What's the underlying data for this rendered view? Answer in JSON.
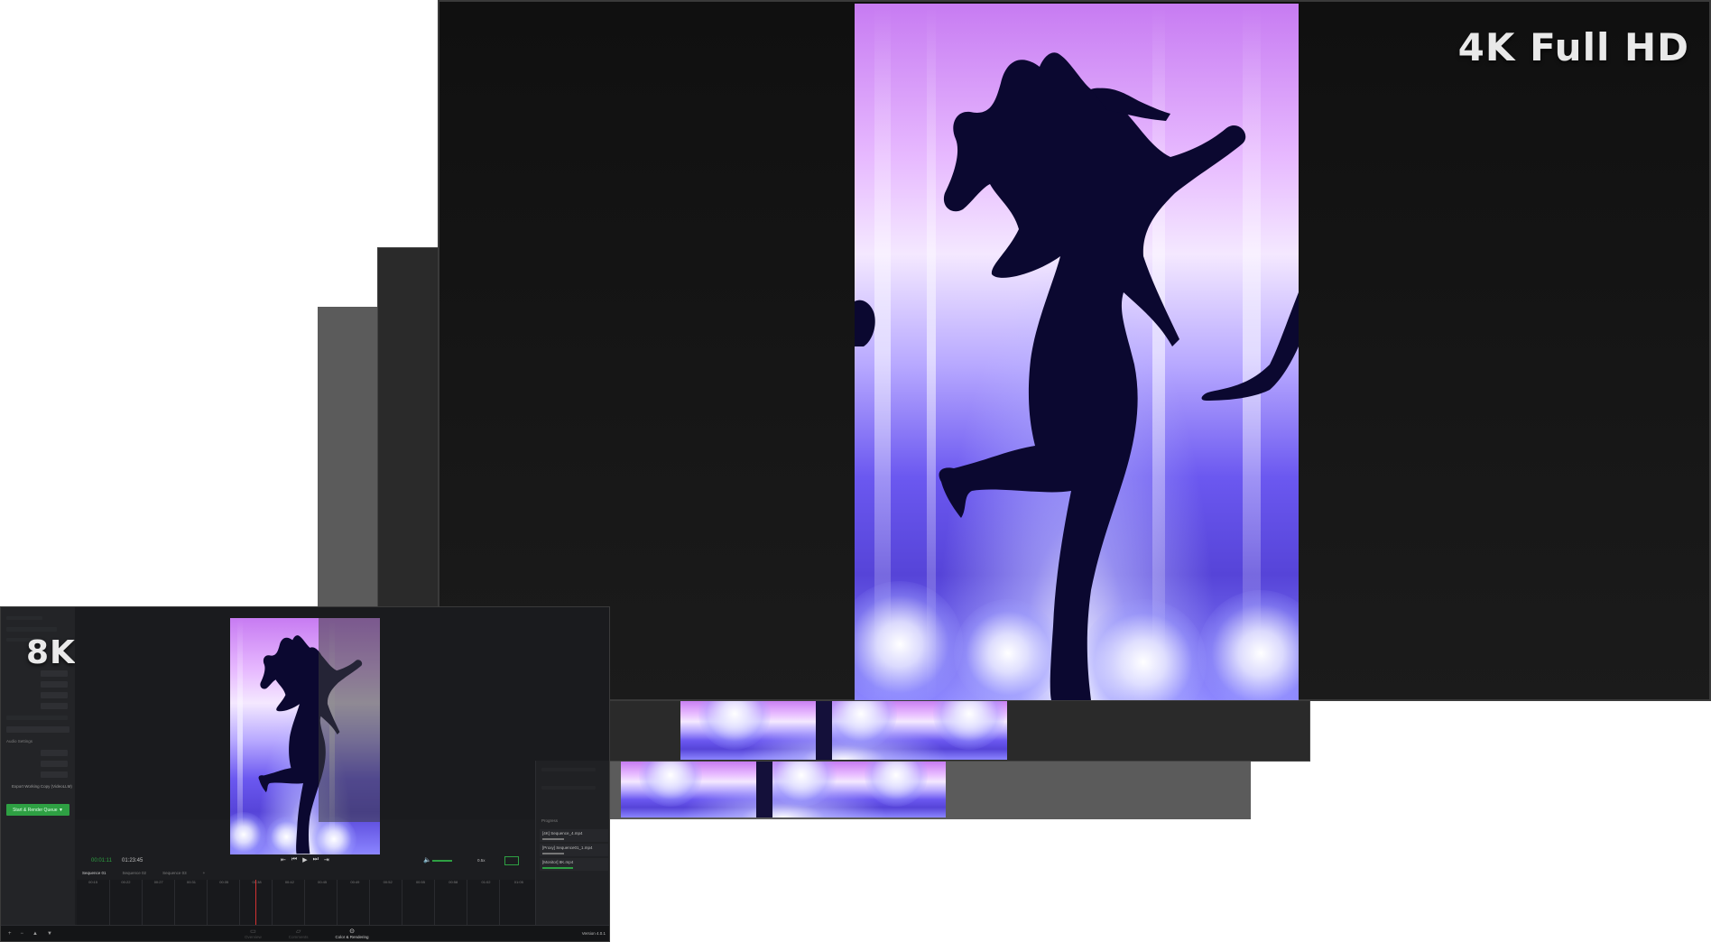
{
  "labels": {
    "top_resolution": "4K Full HD",
    "bottom_resolution": "8K"
  },
  "app": {
    "settings_heading": "Audio Settings",
    "export_link": "Export Working Copy (VideoLLM)",
    "primary_button": "Start & Render Queue ▼",
    "timecode_current": "00:01:11",
    "timecode_total": "01:23:45",
    "speed": "0.5x",
    "sequence_tabs": [
      "Sequence 01",
      "Sequence 02",
      "Sequence 03"
    ],
    "ruler_times": [
      "00:15",
      "00:22",
      "00:27",
      "00:31",
      "00:35",
      "00:38",
      "00:42",
      "00:45",
      "00:49",
      "00:52",
      "00:55",
      "00:58",
      "01:02",
      "01:05"
    ],
    "progress_heading": "Progress",
    "progress_items": [
      {
        "label": "[4K] Sequence_4.mp4"
      },
      {
        "label": "[Proxy] Sequence01_1.mp4"
      },
      {
        "label": "[Monitor] 8K.mp4"
      }
    ],
    "bottom_tabs": [
      "Overview",
      "Comments",
      "Color & Rendering"
    ],
    "version": "Version 4.0.1"
  },
  "colors": {
    "accent_green": "#2ea043",
    "playhead_red": "#d23232"
  }
}
